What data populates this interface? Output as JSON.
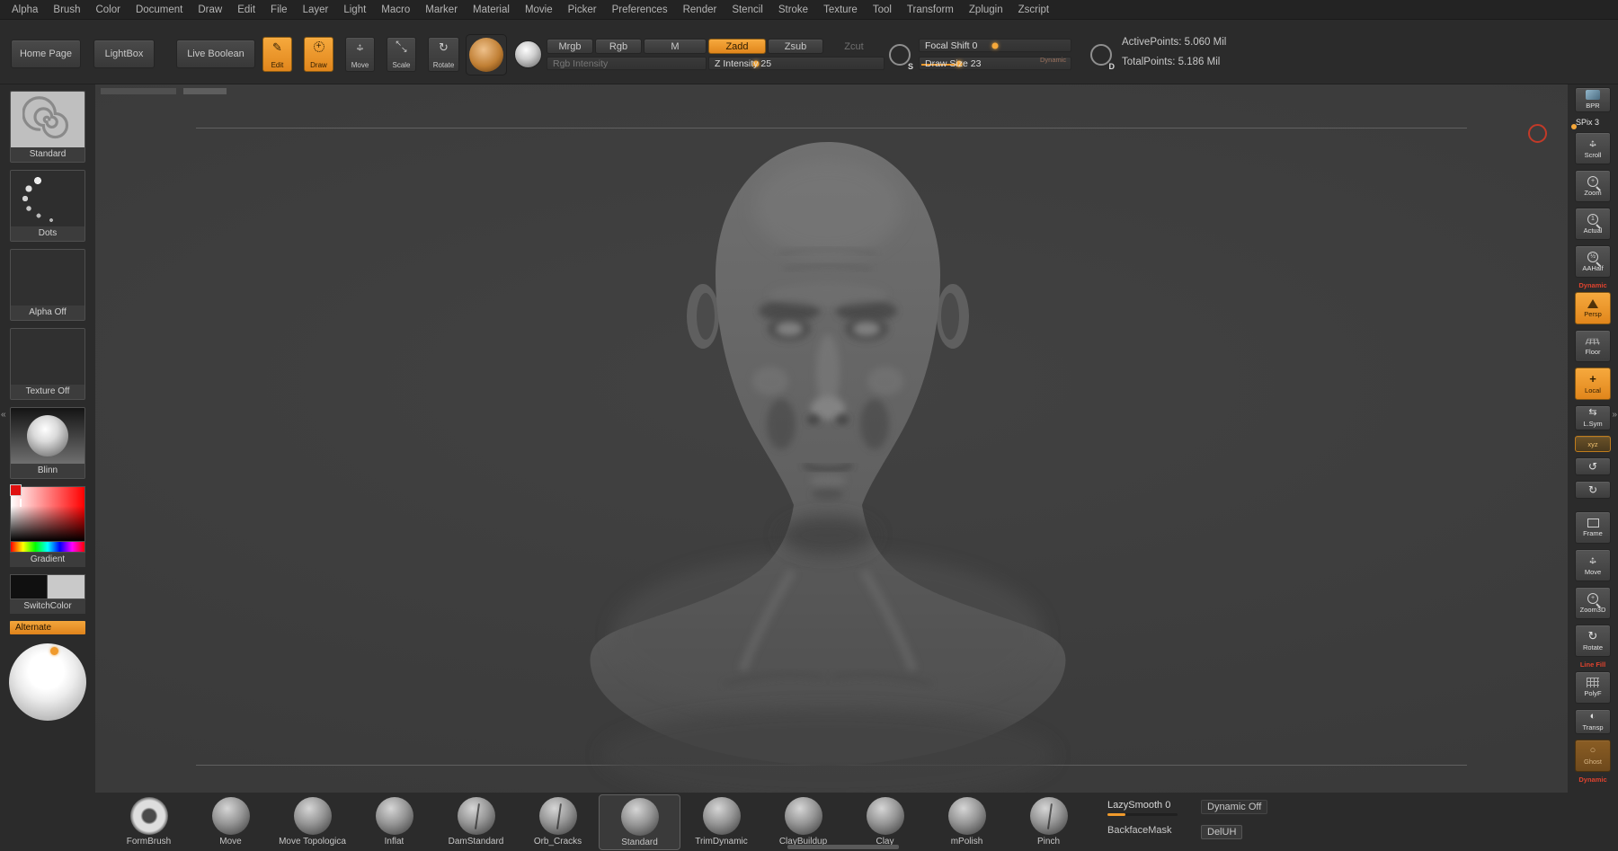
{
  "colors": {
    "accent": "#f09a2c",
    "tag_red": "#e0432e",
    "cursor_red": "#c23a28",
    "canvas_bg": "#3c3c3c"
  },
  "menu_bar": {
    "items": [
      "Alpha",
      "Brush",
      "Color",
      "Document",
      "Draw",
      "Edit",
      "File",
      "Layer",
      "Light",
      "Macro",
      "Marker",
      "Material",
      "Movie",
      "Picker",
      "Preferences",
      "Render",
      "Stencil",
      "Stroke",
      "Texture",
      "Tool",
      "Transform",
      "Zplugin",
      "Zscript"
    ]
  },
  "top_shelf": {
    "home_page": "Home Page",
    "lightbox": "LightBox",
    "live_boolean": "Live Boolean",
    "edit": "Edit",
    "draw": "Draw",
    "move": "Move",
    "scale": "Scale",
    "rotate": "Rotate",
    "mrgb": "Mrgb",
    "rgb": "Rgb",
    "m": "M",
    "rgb_intensity": "Rgb Intensity",
    "zadd": "Zadd",
    "zsub": "Zsub",
    "zcut": "Zcut",
    "z_intensity": "Z Intensity 25",
    "focal_shift": "Focal Shift 0",
    "draw_size": "Draw Size 23",
    "dynamic": "Dynamic",
    "s_letter": "S",
    "d_letter": "D",
    "active_points": "ActivePoints: 5.060 Mil",
    "total_points": "TotalPoints: 5.186 Mil"
  },
  "left_shelf": {
    "brush_label": "Standard",
    "stroke_label": "Dots",
    "alpha_label": "Alpha Off",
    "texture_label": "Texture Off",
    "material_label": "Blinn",
    "gradient_label": "Gradient",
    "switch_label": "SwitchColor",
    "alternate_label": "Alternate"
  },
  "right_shelf": {
    "items": [
      {
        "label": "BPR"
      },
      {
        "label": "SPix 3"
      },
      {
        "label": "Scroll"
      },
      {
        "label": "Zoom"
      },
      {
        "label": "Actual"
      },
      {
        "label": "AAHalf"
      },
      {
        "label": "Persp",
        "tag": "Dynamic"
      },
      {
        "label": "Floor"
      },
      {
        "label": "Local"
      },
      {
        "label": "L.Sym"
      },
      {
        "label": "xyz"
      },
      {
        "label": "Frame"
      },
      {
        "label": "Move"
      },
      {
        "label": "Zoom3D"
      },
      {
        "label": "Rotate"
      },
      {
        "label": "PolyF",
        "tag": "Line Fill"
      },
      {
        "label": "Transp"
      },
      {
        "label": "Ghost"
      },
      {
        "label": "Dynamic"
      }
    ]
  },
  "brush_tray": {
    "brushes": [
      {
        "name": "FormBrush"
      },
      {
        "name": "Move"
      },
      {
        "name": "Move Topologica"
      },
      {
        "name": "Inflat"
      },
      {
        "name": "DamStandard"
      },
      {
        "name": "Orb_Cracks"
      },
      {
        "name": "Standard",
        "selected": true
      },
      {
        "name": "TrimDynamic"
      },
      {
        "name": "ClayBuildup"
      },
      {
        "name": "Clay"
      },
      {
        "name": "mPolish"
      },
      {
        "name": "Pinch"
      }
    ],
    "lazy_smooth": "LazySmooth 0",
    "dynamic_off": "Dynamic Off",
    "backface_mask": "BackfaceMask",
    "del_uh": "DelUH"
  }
}
